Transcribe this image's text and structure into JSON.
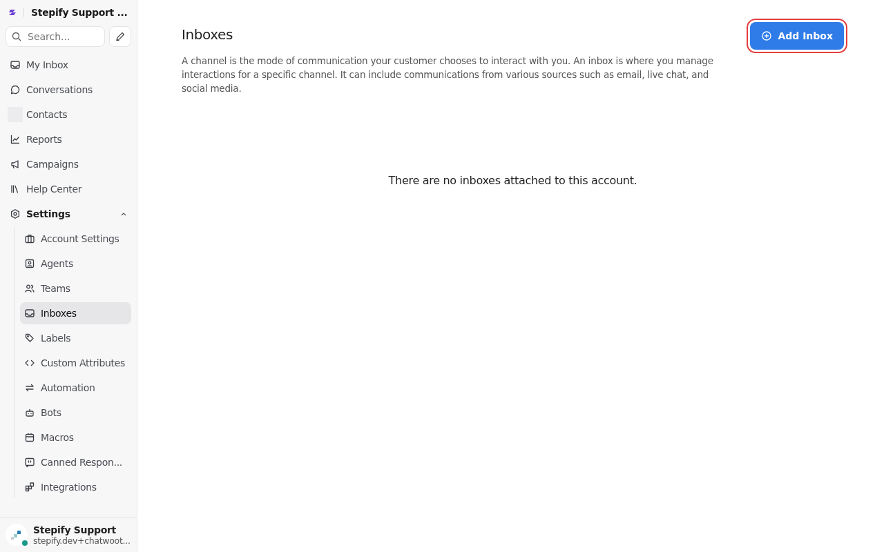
{
  "sidebar": {
    "account_name": "Stepify Support ...",
    "search": {
      "placeholder": "Search..."
    },
    "items": [
      {
        "label": "My Inbox",
        "selected": false
      },
      {
        "label": "Conversations",
        "selected": false
      },
      {
        "label": "Contacts",
        "selected": false
      },
      {
        "label": "Reports",
        "selected": false
      },
      {
        "label": "Campaigns",
        "selected": false
      },
      {
        "label": "Help Center",
        "selected": false
      },
      {
        "label": "Settings",
        "selected": false,
        "expanded": true,
        "children": [
          {
            "label": "Account Settings",
            "selected": false
          },
          {
            "label": "Agents",
            "selected": false
          },
          {
            "label": "Teams",
            "selected": false
          },
          {
            "label": "Inboxes",
            "selected": true
          },
          {
            "label": "Labels",
            "selected": false
          },
          {
            "label": "Custom Attributes",
            "selected": false
          },
          {
            "label": "Automation",
            "selected": false
          },
          {
            "label": "Bots",
            "selected": false
          },
          {
            "label": "Macros",
            "selected": false
          },
          {
            "label": "Canned Respon...",
            "selected": false
          },
          {
            "label": "Integrations",
            "selected": false
          }
        ]
      }
    ],
    "user": {
      "name": "Stepify Support",
      "email": "stepify.dev+chatwoot..."
    }
  },
  "page": {
    "title": "Inboxes",
    "description": "A channel is the mode of communication your customer chooses to interact with you. An inbox is where you manage interactions for a specific channel. It can include communications from various sources such as email, live chat, and social media.",
    "add_button": {
      "label": "Add Inbox",
      "highlighted": true
    },
    "empty_message": "There are no inboxes attached to this account."
  }
}
